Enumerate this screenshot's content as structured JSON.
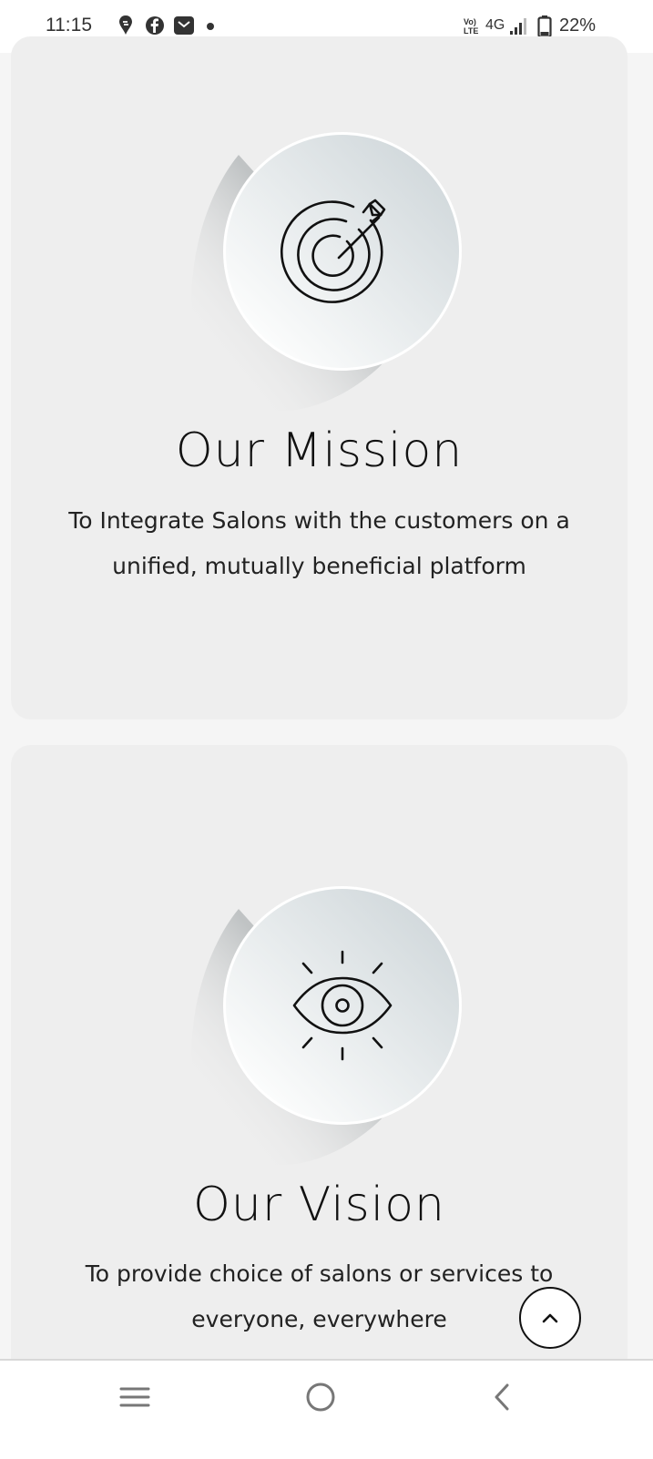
{
  "status_bar": {
    "time": "11:15",
    "network": "4G",
    "battery": "22%",
    "notification_icons": [
      "swiggy-icon",
      "facebook-icon",
      "mail-icon",
      "dot-icon"
    ]
  },
  "mission": {
    "title": "Our Mission",
    "text": "To Integrate Salons with the customers on a unified, mutually beneficial platform",
    "icon": "target-icon"
  },
  "vision": {
    "title": "Our Vision",
    "text": "To provide choice of salons or services to everyone, everywhere",
    "icon": "eye-icon"
  },
  "scroll_top": {
    "icon": "chevron-up-icon"
  },
  "nav": {
    "icons": [
      "recent-apps-icon",
      "home-icon",
      "back-icon"
    ]
  },
  "colors": {
    "page_bg": "#f5f5f5",
    "card_bg": "#eeeeee",
    "text": "#111111",
    "disc_light": "#f4f6f7",
    "disc_dark": "#d3dadd"
  }
}
